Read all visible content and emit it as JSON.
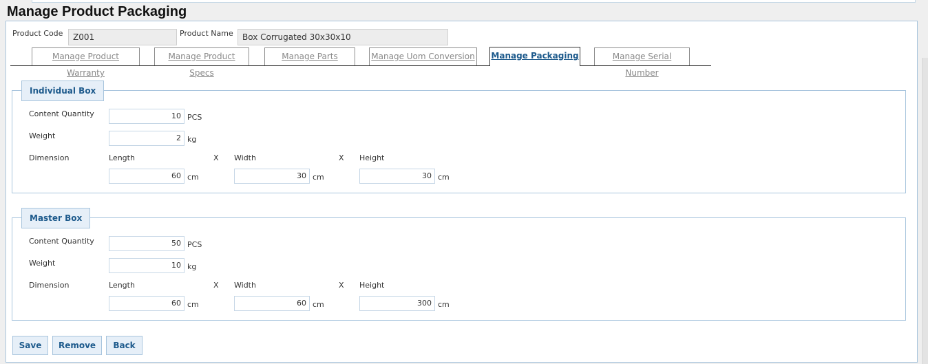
{
  "page_title": "Manage Product Packaging",
  "product": {
    "code_label": "Product Code",
    "code_value": "Z001",
    "name_label": "Product Name",
    "name_value": "Box Corrugated 30x30x10"
  },
  "tabs": [
    {
      "label": "Manage Product Warranty"
    },
    {
      "label": "Manage Product Specs"
    },
    {
      "label": "Manage Parts"
    },
    {
      "label": "Manage Uom Conversion"
    },
    {
      "label": "Manage Packaging"
    },
    {
      "label": "Manage Serial Number"
    }
  ],
  "active_tab": "Manage Packaging",
  "individual_box": {
    "legend": "Individual Box",
    "content_quantity_label": "Content Quantity",
    "content_quantity": "10",
    "content_unit": "PCS",
    "weight_label": "Weight",
    "weight": "2",
    "weight_unit": "kg",
    "dimension_label": "Dimension",
    "length_label": "Length",
    "length": "60",
    "width_label": "Width",
    "width": "30",
    "height_label": "Height",
    "height": "30",
    "dim_unit": "cm",
    "x_sep": "X"
  },
  "master_box": {
    "legend": "Master Box",
    "content_quantity_label": "Content Quantity",
    "content_quantity": "50",
    "content_unit": "PCS",
    "weight_label": "Weight",
    "weight": "10",
    "weight_unit": "kg",
    "dimension_label": "Dimension",
    "length_label": "Length",
    "length": "60",
    "width_label": "Width",
    "width": "60",
    "height_label": "Height",
    "height": "300",
    "dim_unit": "cm",
    "x_sep": "X"
  },
  "buttons": {
    "save": "Save",
    "remove": "Remove",
    "back": "Back"
  },
  "colors": {
    "accent": "#1d5a8c",
    "panel_border": "#a7c4dd",
    "legend_bg": "#e6eff8"
  }
}
